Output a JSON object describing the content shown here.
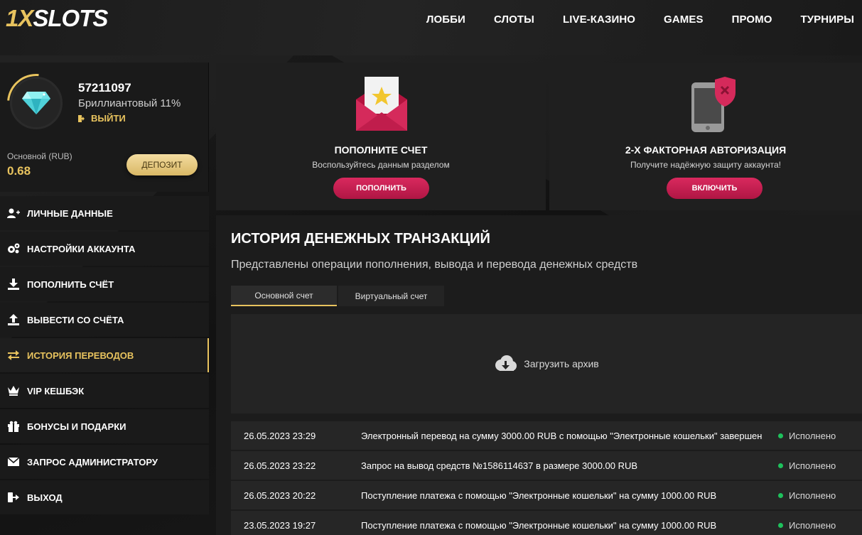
{
  "header": {
    "logo_part1": "1X",
    "logo_part2": "SLOTS",
    "nav": [
      "ЛОББИ",
      "СЛОТЫ",
      "LIVE-КАЗИНО",
      "GAMES",
      "ПРОМО",
      "ТУРНИРЫ"
    ]
  },
  "profile": {
    "user_id": "57211097",
    "level": "Бриллиантовый 11%",
    "logout_label": "ВЫЙТИ",
    "balance_label": "Основной (RUB)",
    "balance_value": "0.68",
    "deposit_label": "ДЕПОЗИТ"
  },
  "menu": [
    {
      "label": "ЛИЧНЫЕ ДАННЫЕ",
      "icon": "user-add-icon"
    },
    {
      "label": "НАСТРОЙКИ АККАУНТА",
      "icon": "gears-icon"
    },
    {
      "label": "ПОПОЛНИТЬ СЧЁТ",
      "icon": "download-icon"
    },
    {
      "label": "ВЫВЕСТИ СО СЧЁТА",
      "icon": "upload-icon"
    },
    {
      "label": "ИСТОРИЯ ПЕРЕВОДОВ",
      "icon": "transfer-arrows-icon",
      "active": true
    },
    {
      "label": "VIP КЕШБЭК",
      "icon": "crown-icon"
    },
    {
      "label": "БОНУСЫ И ПОДАРКИ",
      "icon": "gift-icon"
    },
    {
      "label": "ЗАПРОС АДМИНИСТРАТОРУ",
      "icon": "envelope-icon"
    },
    {
      "label": "ВЫХОД",
      "icon": "logout-icon"
    }
  ],
  "cards": {
    "deposit": {
      "title": "ПОПОЛНИТЕ СЧЕТ",
      "desc": "Воспользуйтесь данным разделом",
      "button": "ПОПОЛНИТЬ",
      "icon": "envelope-star-icon"
    },
    "twofa": {
      "title": "2-Х ФАКТОРНАЯ АВТОРИЗАЦИЯ",
      "desc": "Получите надёжную защиту аккаунта!",
      "button": "ВКЛЮЧИТЬ",
      "icon": "phone-shield-icon"
    }
  },
  "history": {
    "title": "ИСТОРИЯ ДЕНЕЖНЫХ ТРАНЗАКЦИЙ",
    "subtitle": "Представлены операции пополнения, вывода и перевода денежных средств",
    "tabs": [
      "Основной счет",
      "Виртуальный счет"
    ],
    "archive_label": "Загрузить архив",
    "rows": [
      {
        "date": "26.05.2023 23:29",
        "desc": "Электронный перевод на сумму 3000.00 RUB с помощью \"Электронные кошельки\" завершен",
        "status": "Исполнено"
      },
      {
        "date": "26.05.2023 23:22",
        "desc": "Запрос на вывод средств №1586114637 в размере 3000.00 RUB",
        "status": "Исполнено"
      },
      {
        "date": "26.05.2023 20:22",
        "desc": "Поступление платежа с помощью \"Электронные кошельки\" на сумму 1000.00 RUB",
        "status": "Исполнено"
      },
      {
        "date": "23.05.2023 19:27",
        "desc": "Поступление платежа с помощью \"Электронные кошельки\" на сумму 1000.00 RUB",
        "status": "Исполнено"
      }
    ]
  },
  "colors": {
    "accent_gold": "#e8c35e",
    "button_red": "#d9295e",
    "status_green": "#1ec15c"
  }
}
